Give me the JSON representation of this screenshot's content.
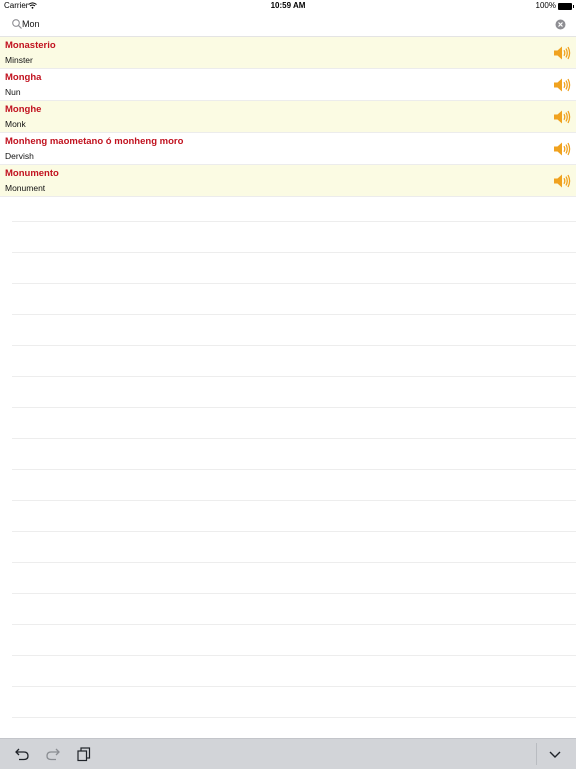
{
  "status_bar": {
    "carrier": "Carrier",
    "time": "10:59 AM",
    "battery": "100%"
  },
  "search": {
    "value": "Mon",
    "placeholder": ""
  },
  "results": [
    {
      "term": "Monasterio",
      "translation": "Minster"
    },
    {
      "term": "Mongha",
      "translation": "Nun"
    },
    {
      "term": "Monghe",
      "translation": "Monk"
    },
    {
      "term": "Monheng maometano ó monheng moro",
      "translation": "Dervish"
    },
    {
      "term": "Monumento",
      "translation": "Monument"
    }
  ],
  "icons": {
    "search": "search-icon",
    "clear": "clear-icon",
    "speaker": "speaker-icon",
    "undo": "undo-icon",
    "redo": "redo-icon",
    "copy": "copy-icon",
    "collapse": "chevron-down-icon"
  },
  "colors": {
    "term": "#c1121f",
    "alt_row": "#fbfbe3",
    "speaker": "#f0a21f",
    "toolbar": "#d2d4d8"
  }
}
